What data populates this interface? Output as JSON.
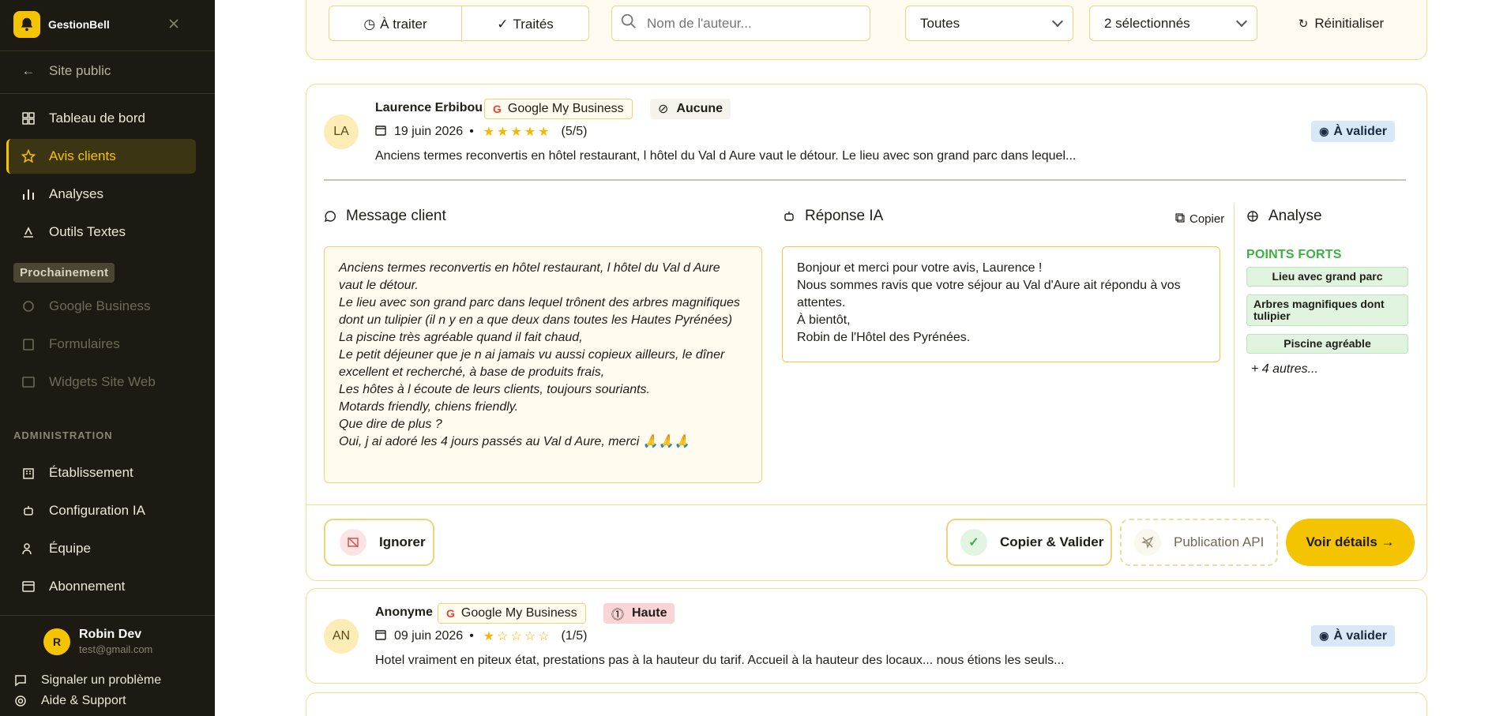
{
  "app": {
    "name": "GestionBell"
  },
  "sidebar": {
    "public_site": "Site public",
    "nav": [
      {
        "label": "Tableau de bord"
      },
      {
        "label": "Avis clients"
      },
      {
        "label": "Analyses"
      },
      {
        "label": "Outils Textes"
      }
    ],
    "soon_badge": "Prochainement",
    "soon": [
      {
        "label": "Google Business"
      },
      {
        "label": "Formulaires"
      },
      {
        "label": "Widgets Site Web"
      }
    ],
    "admin_title": "ADMINISTRATION",
    "admin": [
      {
        "label": "Établissement"
      },
      {
        "label": "Configuration IA"
      },
      {
        "label": "Équipe"
      },
      {
        "label": "Abonnement"
      }
    ],
    "user": {
      "initial": "R",
      "name": "Robin Dev",
      "email": "test@gmail.com"
    },
    "footer": {
      "report": "Signaler un problème",
      "help": "Aide & Support"
    }
  },
  "filters": {
    "tab_todo": "À traiter",
    "tab_done": "Traités",
    "search_placeholder": "Nom de l'auteur...",
    "select_all": "Toutes",
    "select_multi": "2 sélectionnés",
    "reset": "Réinitialiser"
  },
  "reviews": [
    {
      "initials": "LA",
      "author": "Laurence Erbibou",
      "source": "Google My Business",
      "priority": "Aucune",
      "date": "19 juin 2026",
      "stars": "★★★★★",
      "rating": "(5/5)",
      "status": "À valider",
      "excerpt": "Anciens termes reconvertis en hôtel restaurant, l hôtel du Val d Aure vaut le détour. Le lieu avec son grand parc dans lequel...",
      "client_title": "Message client",
      "client_lines": [
        "Anciens termes reconvertis en hôtel restaurant, l hôtel du Val d Aure vaut le détour.",
        "Le lieu avec son grand parc dans lequel trônent des arbres magnifiques dont un tulipier (il n y en a que deux dans toutes les Hautes Pyrénées)",
        "La piscine très agréable quand il fait chaud,",
        "Le petit déjeuner que je n ai jamais vu aussi copieux ailleurs, le dîner excellent et recherché, à base de produits frais,",
        "Les hôtes à l écoute de leurs clients, toujours souriants.",
        "Motards friendly, chiens friendly.",
        "Que dire de plus ?",
        "Oui, j ai adoré les 4 jours passés au Val d Aure, merci 🙏🙏🙏"
      ],
      "ai_title": "Réponse IA",
      "copy_label": "Copier",
      "ai_lines": [
        "Bonjour et merci pour votre avis, Laurence !",
        "Nous sommes ravis que votre séjour au Val d'Aure ait répondu à vos attentes.",
        "À bientôt,",
        "Robin de l'Hôtel des Pyrénées."
      ],
      "analysis_title": "Analyse",
      "strengths_title": "POINTS FORTS",
      "strengths": [
        "Lieu avec grand parc",
        "Arbres magnifiques dont tulipier",
        "Piscine agréable"
      ],
      "more": "+ 4 autres...",
      "actions": {
        "ignore": "Ignorer",
        "copy_validate": "Copier & Valider",
        "api": "Publication API",
        "details": "Voir détails →"
      }
    },
    {
      "initials": "AN",
      "author": "Anonyme",
      "source": "Google My Business",
      "priority": "Haute",
      "date": "09 juin 2026",
      "stars": "★☆☆☆☆",
      "rating": "(1/5)",
      "status": "À valider",
      "excerpt": "Hotel vraiment en piteux état, prestations pas à la hauteur du tarif. Accueil à la hauteur des locaux... nous étions les seuls..."
    }
  ]
}
